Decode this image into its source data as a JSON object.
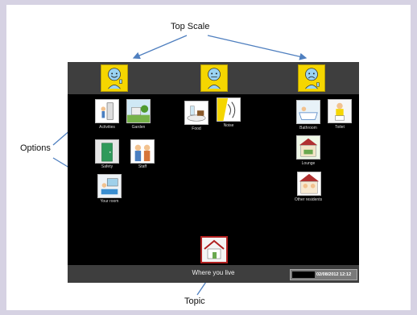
{
  "annotations": {
    "top_scale": "Top Scale",
    "options": "Options",
    "topic": "Topic"
  },
  "scale_faces": [
    {
      "icon": "thumbs-up-face-icon"
    },
    {
      "icon": "neutral-face-icon"
    },
    {
      "icon": "thumbs-down-face-icon"
    }
  ],
  "options": [
    {
      "label": "Activities",
      "icon": "activities-icon"
    },
    {
      "label": "Garden",
      "icon": "garden-icon"
    },
    {
      "label": "Food",
      "icon": "food-icon"
    },
    {
      "label": "Noise",
      "icon": "noise-icon"
    },
    {
      "label": "Bathroom",
      "icon": "bathroom-icon"
    },
    {
      "label": "Toilet",
      "icon": "toilet-icon"
    },
    {
      "label": "Safety",
      "icon": "safety-icon"
    },
    {
      "label": "Staff",
      "icon": "staff-icon"
    },
    {
      "label": "Lounge",
      "icon": "lounge-icon"
    },
    {
      "label": "Your room",
      "icon": "your-room-icon"
    },
    {
      "label": "Other residents",
      "icon": "other-residents-icon"
    }
  ],
  "topic": {
    "label": "Where you live",
    "icon": "house-icon"
  },
  "status": {
    "datetime": "02/08/2012 12:12"
  },
  "colors": {
    "face_bg": "#f5d600",
    "app_bg": "#000000",
    "bar_bg": "#3e3e3e",
    "topic_border": "#b02020"
  }
}
